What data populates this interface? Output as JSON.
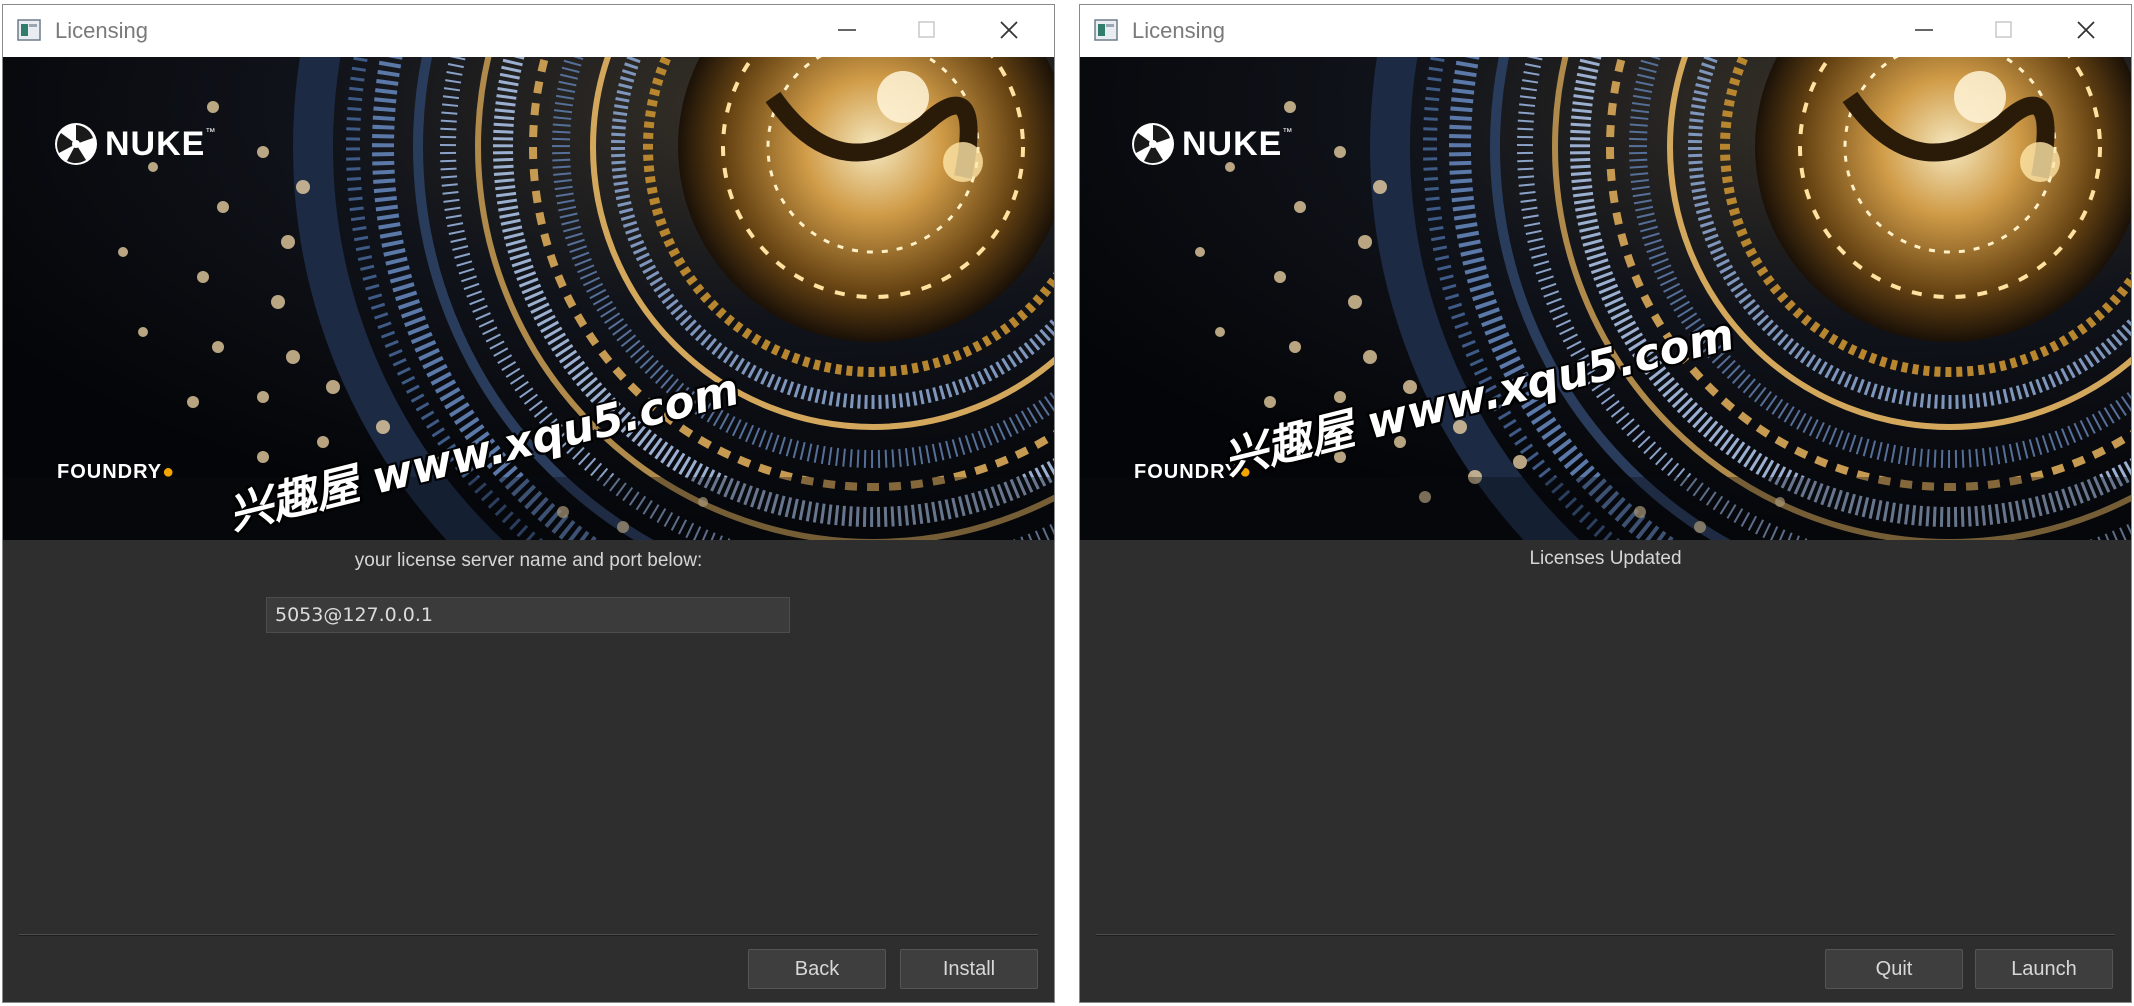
{
  "left_window": {
    "title": "Licensing",
    "brand": {
      "product": "NUKE",
      "company": "FOUNDRY"
    },
    "prompt": "your license server name and port below:",
    "server_field": {
      "value": "5053@127.0.0.1"
    },
    "buttons": {
      "back": "Back",
      "install": "Install"
    }
  },
  "right_window": {
    "title": "Licensing",
    "brand": {
      "product": "NUKE",
      "company": "FOUNDRY"
    },
    "status": "Licenses Updated",
    "buttons": {
      "quit": "Quit",
      "launch": "Launch"
    }
  },
  "watermark": "兴趣屋 www.xqu5.com",
  "colors": {
    "panel_bg": "#2e2e2e",
    "titlebar_bg": "#ffffff",
    "accent_gold": "#f2a400",
    "button_bg": "#3e3e3e"
  }
}
